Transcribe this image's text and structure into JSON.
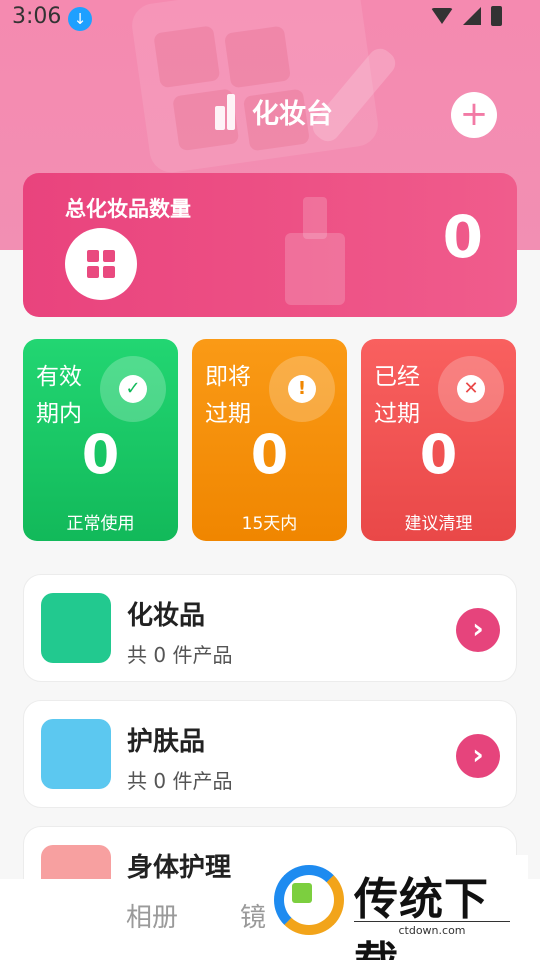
{
  "status_bar": {
    "time": "3:06"
  },
  "header": {
    "title": "化妆台",
    "add_symbol": "+"
  },
  "total_card": {
    "label": "总化妆品数量",
    "count": "0"
  },
  "stats": [
    {
      "title": "有效期内",
      "count": "0",
      "subtitle": "正常使用",
      "icon": "check-icon",
      "glyph": "✓"
    },
    {
      "title": "即将过期",
      "count": "0",
      "subtitle": "15天内",
      "icon": "warning-icon",
      "glyph": "!"
    },
    {
      "title": "已经过期",
      "count": "0",
      "subtitle": "建议清理",
      "icon": "close-icon",
      "glyph": "✕"
    }
  ],
  "categories": [
    {
      "name": "化妆品",
      "subtitle": "共 0 件产品",
      "icon_color": "#22c98f",
      "icon": "makeup-brush-icon"
    },
    {
      "name": "护肤品",
      "subtitle": "共 0 件产品",
      "icon_color": "#5cc8f0",
      "icon": "skincare-icon"
    },
    {
      "name": "身体护理",
      "subtitle": "",
      "icon_color": "#f7a0a0",
      "icon": "body-care-icon"
    }
  ],
  "bottom_nav": {
    "tab1": "相册",
    "tab2": "镜"
  },
  "watermark": {
    "brand": "传统下载",
    "url": "ctdown.com"
  },
  "colors": {
    "pink": "#f28fb3",
    "accent": "#e6447c",
    "green": "#12b95a",
    "orange": "#f08600",
    "red": "#e94848"
  }
}
